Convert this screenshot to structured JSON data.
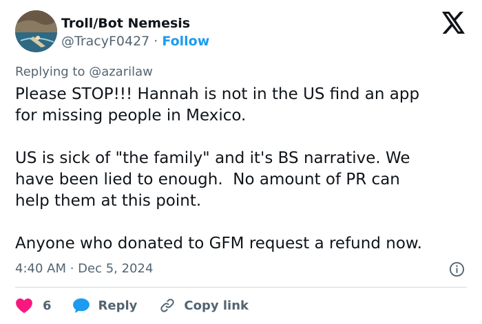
{
  "author": {
    "name": "Troll/Bot Nemesis",
    "handle": "@TracyF0427",
    "separator": "·",
    "follow_label": "Follow",
    "avatar_icon": "avatar-photo-icon"
  },
  "brand": {
    "logo_icon": "x-logo-icon"
  },
  "reply_context": {
    "text": "Replying to @azarilaw"
  },
  "tweet": {
    "lines": [
      "Please STOP!!! Hannah is not in the US find an app",
      "for missing people in Mexico.",
      "",
      "US is sick of \"the family\" and it's BS narrative. We",
      "have been lied to enough.  No amount of PR can",
      "help them at this point.",
      "",
      "Anyone who donated to GFM request a refund now."
    ]
  },
  "meta": {
    "timestamp": "4:40 AM · Dec 5, 2024",
    "info_icon": "info-icon"
  },
  "actions": {
    "like_count": "6",
    "reply_label": "Reply",
    "copy_link_label": "Copy link"
  },
  "colors": {
    "text": "#0f1419",
    "secondary": "#536471",
    "accent": "#1d9bf0",
    "heart": "#f91880",
    "divider": "#cfd9de"
  }
}
